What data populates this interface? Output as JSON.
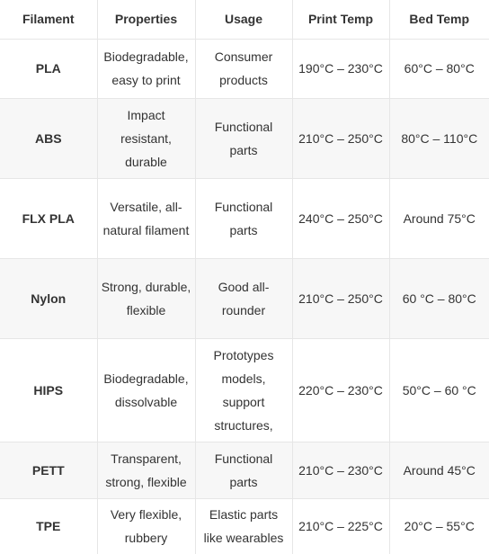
{
  "table": {
    "headers": [
      "Filament",
      "Properties",
      "Usage",
      "Print Temp",
      "Bed Temp"
    ],
    "rows": [
      {
        "filament": "PLA",
        "properties": "Biodegradable, easy to print",
        "usage": "Consumer products",
        "print_temp": "190°C – 230°C",
        "bed_temp": "60°C – 80°C"
      },
      {
        "filament": "ABS",
        "properties": "Impact resistant, durable",
        "usage": "Functional parts",
        "print_temp": "210°C – 250°C",
        "bed_temp": "80°C – 110°C"
      },
      {
        "filament": "FLX PLA",
        "properties": "Versatile, all-natural filament",
        "usage": "Functional parts",
        "print_temp": "240°C – 250°C",
        "bed_temp": "Around 75°C"
      },
      {
        "filament": "Nylon",
        "properties": "Strong, durable, flexible",
        "usage": "Good all-rounder",
        "print_temp": "210°C – 250°C",
        "bed_temp": "60 °C – 80°C"
      },
      {
        "filament": "HIPS",
        "properties": "Biodegradable, dissolvable",
        "usage": "Prototypes models, support structures,",
        "print_temp": "220°C – 230°C",
        "bed_temp": "50°C – 60 °C"
      },
      {
        "filament": "PETT",
        "properties": "Transparent, strong, flexible",
        "usage": "Functional parts",
        "print_temp": "210°C – 230°C",
        "bed_temp": "Around 45°C"
      },
      {
        "filament": "TPE",
        "properties": "Very flexible, rubbery",
        "usage": "Elastic parts like wearables",
        "print_temp": "210°C – 225°C",
        "bed_temp": "20°C – 55°C"
      }
    ]
  }
}
